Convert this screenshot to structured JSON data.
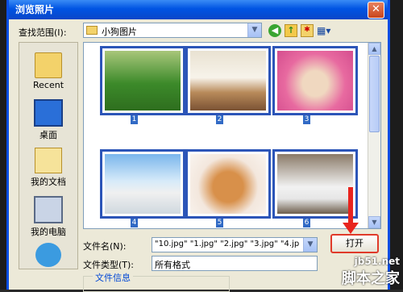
{
  "window": {
    "title": "浏览照片",
    "close_symbol": "✕"
  },
  "toolbar": {
    "lookin_label": "查找范围(I):",
    "lookin_value": "小狗图片",
    "back_icon": "back-arrow-icon",
    "up_icon": "up-folder-icon",
    "newfolder_icon": "new-folder-icon",
    "view_icon": "view-menu-icon",
    "back_glyph": "◀",
    "up_glyph": "↑",
    "new_glyph": "✱",
    "view_glyph": "▦▾",
    "combo_arrow": "▼"
  },
  "places": [
    {
      "label": "Recent",
      "icon": "recent-folder-icon"
    },
    {
      "label": "桌面",
      "icon": "desktop-icon"
    },
    {
      "label": "我的文档",
      "icon": "my-documents-icon"
    },
    {
      "label": "我的电脑",
      "icon": "my-computer-icon"
    },
    {
      "label": "",
      "icon": "network-icon"
    }
  ],
  "files": [
    {
      "caption": "1",
      "content": "five puppies on grass"
    },
    {
      "caption": "2",
      "content": "three white puppies in basket"
    },
    {
      "caption": "3",
      "content": "two puppies on pink blanket"
    },
    {
      "caption": "4",
      "content": "puppy on blue-white background"
    },
    {
      "caption": "5",
      "content": "two brown-white puppies"
    },
    {
      "caption": "6",
      "content": "two white fluffy puppies on bench"
    }
  ],
  "form": {
    "filename_label": "文件名(N):",
    "filename_value": "\"10.jpg\" \"1.jpg\" \"2.jpg\" \"3.jpg\" \"4.jp",
    "filetype_label": "文件类型(T):",
    "filetype_value": "所有格式",
    "open_button": "打开"
  },
  "file_info": {
    "label": "文件信息"
  },
  "watermark": {
    "line1": "jb51.net",
    "line2": "脚本之家"
  },
  "colors": {
    "titlebar": "#0054e3",
    "selection": "#316ac5",
    "annotation": "#e8241e"
  }
}
